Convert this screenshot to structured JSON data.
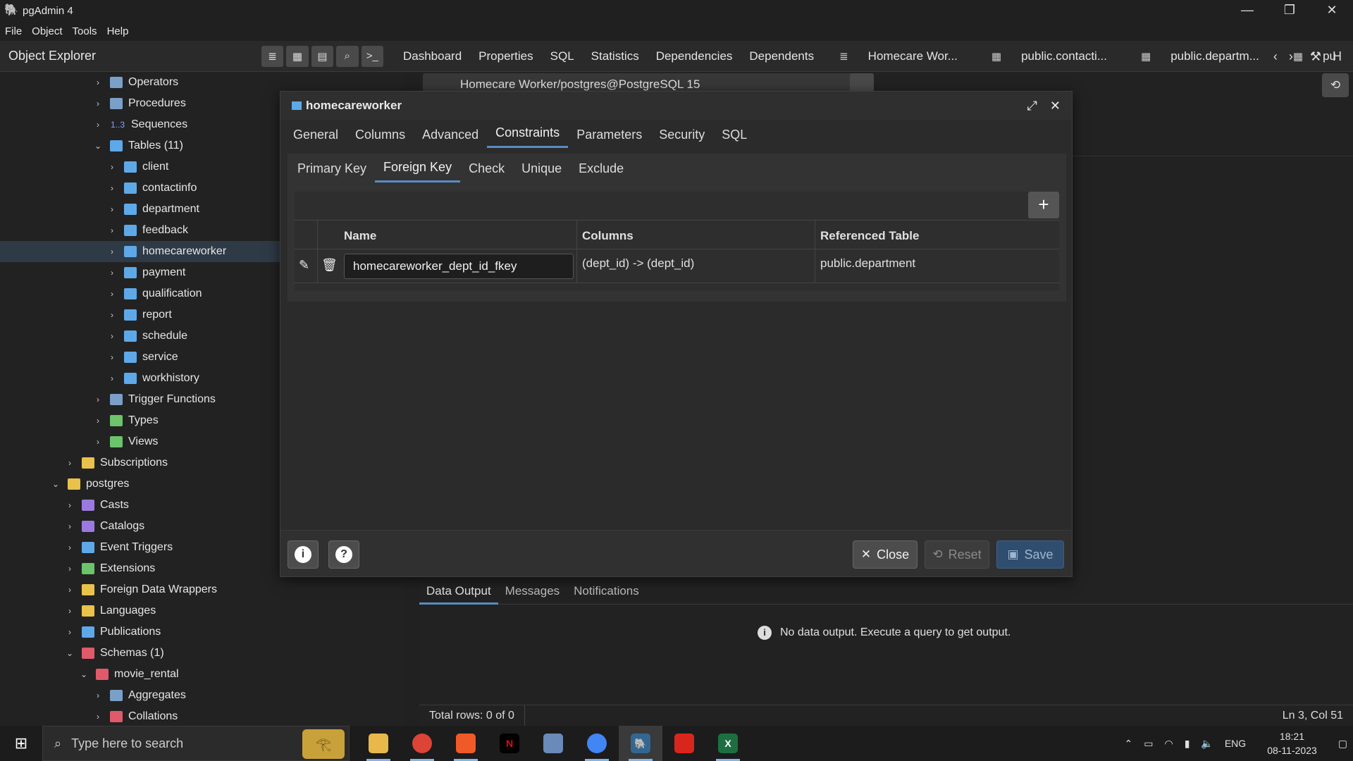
{
  "window": {
    "title": "pgAdmin 4",
    "controls": [
      "—",
      "❐",
      "✕"
    ]
  },
  "menu": [
    "File",
    "Object",
    "Tools",
    "Help"
  ],
  "toolbar": {
    "explorer_title": "Object Explorer",
    "tabs": [
      "Dashboard",
      "Properties",
      "SQL",
      "Statistics",
      "Dependencies",
      "Dependents"
    ],
    "doc_tabs": [
      "Homecare Wor...",
      "public.contacti...",
      "public.departm...",
      "pu",
      "H"
    ]
  },
  "tree": [
    {
      "label": "Operators",
      "depth": 3,
      "chev": "›",
      "icon": "operators-icon",
      "cls": "gen"
    },
    {
      "label": "Procedures",
      "depth": 3,
      "chev": "›",
      "icon": "procedures-icon",
      "cls": "gen"
    },
    {
      "label": "Sequences",
      "depth": 3,
      "chev": "›",
      "icon": "sequences-icon",
      "cls": "seq"
    },
    {
      "label": "Tables (11)",
      "depth": 3,
      "chev": "⌄",
      "icon": "tables-icon",
      "cls": "table"
    },
    {
      "label": "client",
      "depth": 4,
      "chev": "›",
      "icon": "table-icon",
      "cls": "table"
    },
    {
      "label": "contactinfo",
      "depth": 4,
      "chev": "›",
      "icon": "table-icon",
      "cls": "table"
    },
    {
      "label": "department",
      "depth": 4,
      "chev": "›",
      "icon": "table-icon",
      "cls": "table"
    },
    {
      "label": "feedback",
      "depth": 4,
      "chev": "›",
      "icon": "table-icon",
      "cls": "table"
    },
    {
      "label": "homecareworker",
      "depth": 4,
      "chev": "›",
      "icon": "table-icon",
      "cls": "table",
      "selected": true
    },
    {
      "label": "payment",
      "depth": 4,
      "chev": "›",
      "icon": "table-icon",
      "cls": "table"
    },
    {
      "label": "qualification",
      "depth": 4,
      "chev": "›",
      "icon": "table-icon",
      "cls": "table"
    },
    {
      "label": "report",
      "depth": 4,
      "chev": "›",
      "icon": "table-icon",
      "cls": "table"
    },
    {
      "label": "schedule",
      "depth": 4,
      "chev": "›",
      "icon": "table-icon",
      "cls": "table"
    },
    {
      "label": "service",
      "depth": 4,
      "chev": "›",
      "icon": "table-icon",
      "cls": "table"
    },
    {
      "label": "workhistory",
      "depth": 4,
      "chev": "›",
      "icon": "table-icon",
      "cls": "table"
    },
    {
      "label": "Trigger Functions",
      "depth": 3,
      "chev": "›",
      "icon": "trigger-functions-icon",
      "cls": "gen"
    },
    {
      "label": "Types",
      "depth": 3,
      "chev": "›",
      "icon": "types-icon",
      "cls": "green"
    },
    {
      "label": "Views",
      "depth": 3,
      "chev": "›",
      "icon": "views-icon",
      "cls": "green"
    },
    {
      "label": "Subscriptions",
      "depth": 1,
      "chev": "›",
      "icon": "subscriptions-icon",
      "cls": "yellow"
    },
    {
      "label": "postgres",
      "depth": 0,
      "chev": "⌄",
      "icon": "database-icon",
      "cls": "yellow"
    },
    {
      "label": "Casts",
      "depth": 1,
      "chev": "›",
      "icon": "casts-icon",
      "cls": "purple"
    },
    {
      "label": "Catalogs",
      "depth": 1,
      "chev": "›",
      "icon": "catalogs-icon",
      "cls": "purple"
    },
    {
      "label": "Event Triggers",
      "depth": 1,
      "chev": "›",
      "icon": "event-triggers-icon",
      "cls": "table"
    },
    {
      "label": "Extensions",
      "depth": 1,
      "chev": "›",
      "icon": "extensions-icon",
      "cls": "green"
    },
    {
      "label": "Foreign Data Wrappers",
      "depth": 1,
      "chev": "›",
      "icon": "foreign-data-wrappers-icon",
      "cls": "yellow"
    },
    {
      "label": "Languages",
      "depth": 1,
      "chev": "›",
      "icon": "languages-icon",
      "cls": "yellow"
    },
    {
      "label": "Publications",
      "depth": 1,
      "chev": "›",
      "icon": "publications-icon",
      "cls": "table"
    },
    {
      "label": "Schemas (1)",
      "depth": 1,
      "chev": "⌄",
      "icon": "schemas-icon",
      "cls": "red"
    },
    {
      "label": "movie_rental",
      "depth": 2,
      "chev": "⌄",
      "icon": "schema-icon",
      "cls": "red"
    },
    {
      "label": "Aggregates",
      "depth": 3,
      "chev": "›",
      "icon": "aggregates-icon",
      "cls": "gen"
    },
    {
      "label": "Collations",
      "depth": 3,
      "chev": "›",
      "icon": "collations-icon",
      "cls": "red"
    }
  ],
  "query_bar": {
    "connection": "Homecare Worker/postgres@PostgreSQL 15"
  },
  "dialog": {
    "title": "homecareworker",
    "tabs": [
      "General",
      "Columns",
      "Advanced",
      "Constraints",
      "Parameters",
      "Security",
      "SQL"
    ],
    "active_tab": "Constraints",
    "sub_tabs": [
      "Primary Key",
      "Foreign Key",
      "Check",
      "Unique",
      "Exclude"
    ],
    "active_sub_tab": "Foreign Key",
    "grid": {
      "headers": [
        "Name",
        "Columns",
        "Referenced Table"
      ],
      "rows": [
        {
          "name": "homecareworker_dept_id_fkey",
          "columns": "(dept_id) -> (dept_id)",
          "referenced_table": "public.department"
        }
      ]
    },
    "buttons": {
      "close": "Close",
      "reset": "Reset",
      "save": "Save"
    }
  },
  "output": {
    "tabs": [
      "Data Output",
      "Messages",
      "Notifications"
    ],
    "active": "Data Output",
    "message": "No data output. Execute a query to get output."
  },
  "status": {
    "total_rows": "Total rows: 0 of 0",
    "cursor": "Ln 3, Col 51"
  },
  "taskbar": {
    "search_placeholder": "Type here to search",
    "language": "ENG",
    "time": "18:21",
    "date": "08-11-2023"
  }
}
